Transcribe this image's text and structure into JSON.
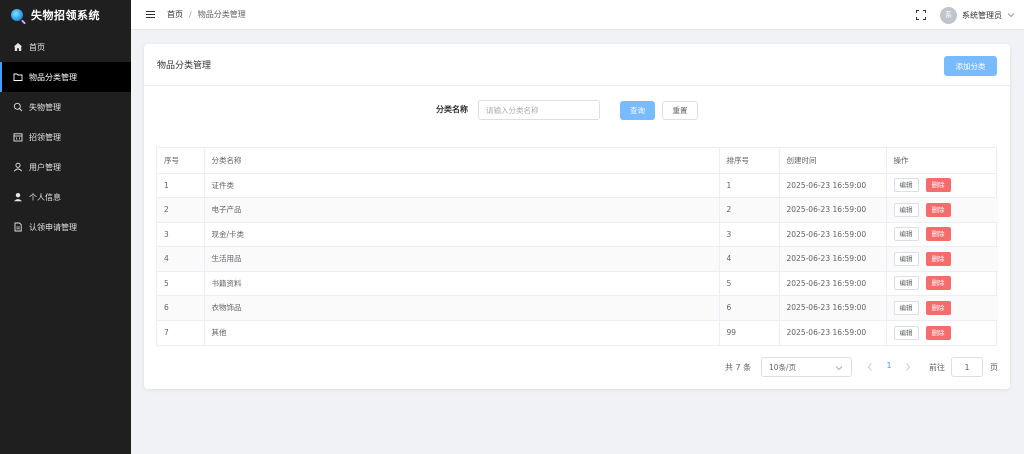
{
  "app": {
    "title": "失物招领系统"
  },
  "sidebar": {
    "items": [
      {
        "label": "首页",
        "icon": "home-icon",
        "active": false
      },
      {
        "label": "物品分类管理",
        "icon": "folder-icon",
        "active": true
      },
      {
        "label": "失物管理",
        "icon": "search-icon",
        "active": false
      },
      {
        "label": "招领管理",
        "icon": "calendar-icon",
        "active": false
      },
      {
        "label": "用户管理",
        "icon": "user-icon",
        "active": false
      },
      {
        "label": "个人信息",
        "icon": "user-filled-icon",
        "active": false
      },
      {
        "label": "认领申请管理",
        "icon": "document-icon",
        "active": false
      }
    ]
  },
  "header": {
    "breadcrumb": [
      "首页",
      "物品分类管理"
    ],
    "breadcrumb_separator": "/",
    "user": {
      "avatar_text": "系",
      "name": "系统管理员"
    }
  },
  "page": {
    "title": "物品分类管理",
    "add_button": "添加分类",
    "search": {
      "label": "分类名称",
      "placeholder": "请输入分类名称",
      "query_button": "查询",
      "reset_button": "重置"
    },
    "table": {
      "columns": [
        "序号",
        "分类名称",
        "排序号",
        "创建时间",
        "操作"
      ],
      "rows": [
        {
          "index": "1",
          "name": "证件类",
          "sort": "1",
          "created": "2025-06-23 16:59:00"
        },
        {
          "index": "2",
          "name": "电子产品",
          "sort": "2",
          "created": "2025-06-23 16:59:00"
        },
        {
          "index": "3",
          "name": "现金/卡类",
          "sort": "3",
          "created": "2025-06-23 16:59:00"
        },
        {
          "index": "4",
          "name": "生活用品",
          "sort": "4",
          "created": "2025-06-23 16:59:00"
        },
        {
          "index": "5",
          "name": "书籍资料",
          "sort": "5",
          "created": "2025-06-23 16:59:00"
        },
        {
          "index": "6",
          "name": "衣物饰品",
          "sort": "6",
          "created": "2025-06-23 16:59:00"
        },
        {
          "index": "7",
          "name": "其他",
          "sort": "99",
          "created": "2025-06-23 16:59:00"
        }
      ],
      "edit_label": "编辑",
      "delete_label": "删除"
    },
    "pagination": {
      "total_text": "共 7 条",
      "page_size": "10条/页",
      "current_page": "1",
      "goto_label": "前往",
      "goto_value": "1",
      "page_suffix": "页"
    }
  },
  "colors": {
    "sidebar_bg": "#1f1f1f",
    "primary": "#409eff",
    "primary_light": "#79bbff",
    "danger": "#f56c6c"
  }
}
